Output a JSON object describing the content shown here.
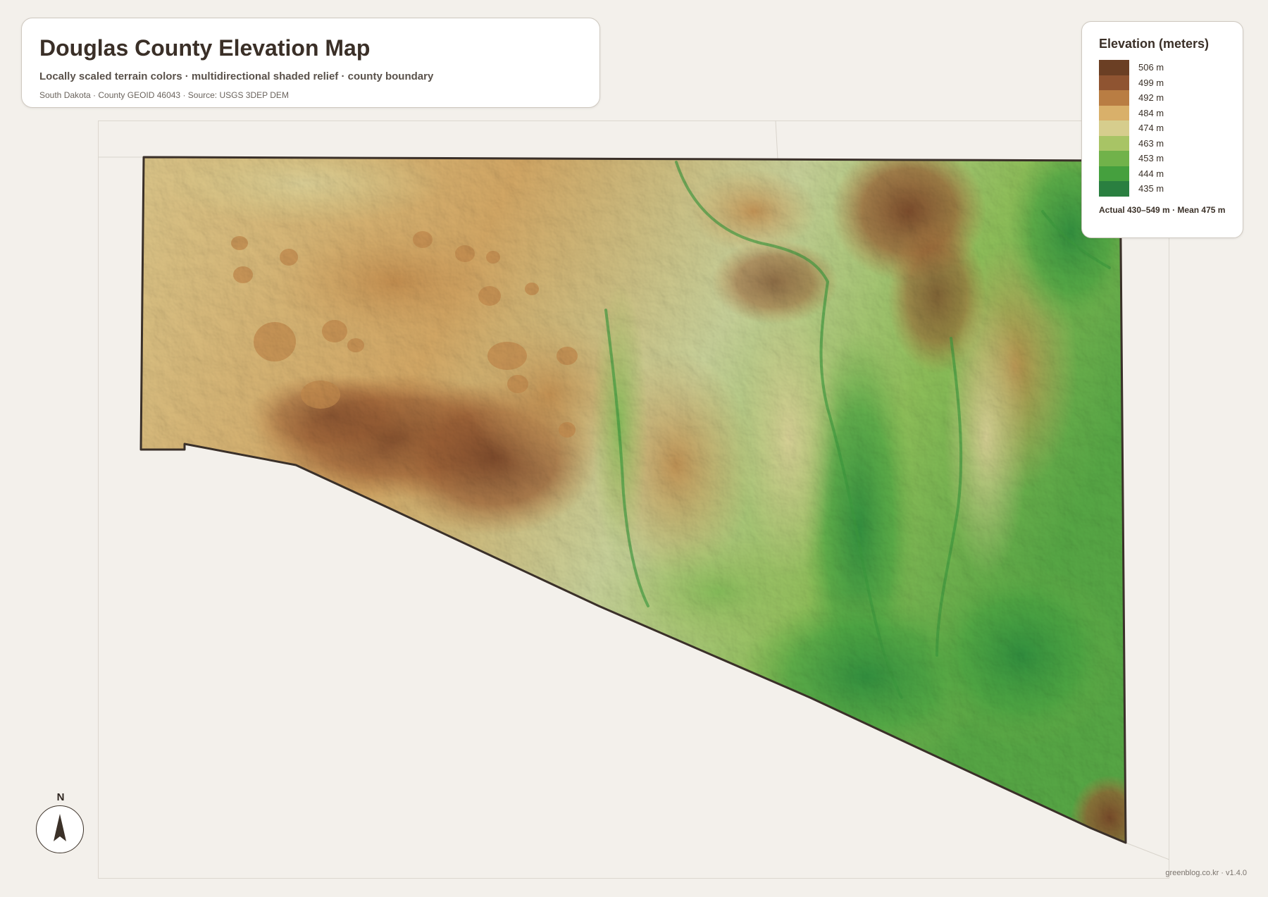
{
  "header": {
    "title": "Douglas County Elevation Map",
    "subtitle": "Locally scaled terrain colors · multidirectional shaded relief · county boundary",
    "meta": "South Dakota · County GEOID 46043 · Source: USGS 3DEP DEM"
  },
  "legend": {
    "title": "Elevation (meters)",
    "items": [
      {
        "label": "506 m",
        "color": "#6b3f24"
      },
      {
        "label": "499 m",
        "color": "#8f5431"
      },
      {
        "label": "492 m",
        "color": "#b97d43"
      },
      {
        "label": "484 m",
        "color": "#d9b06a"
      },
      {
        "label": "474 m",
        "color": "#d6cd8d"
      },
      {
        "label": "463 m",
        "color": "#a8c465"
      },
      {
        "label": "453 m",
        "color": "#71b24a"
      },
      {
        "label": "444 m",
        "color": "#45a03e"
      },
      {
        "label": "435 m",
        "color": "#2a7f40"
      }
    ],
    "stats": "Actual 430–549 m · Mean 475 m"
  },
  "compass": {
    "label": "N"
  },
  "credit": "greenblog.co.kr · v1.4.0"
}
